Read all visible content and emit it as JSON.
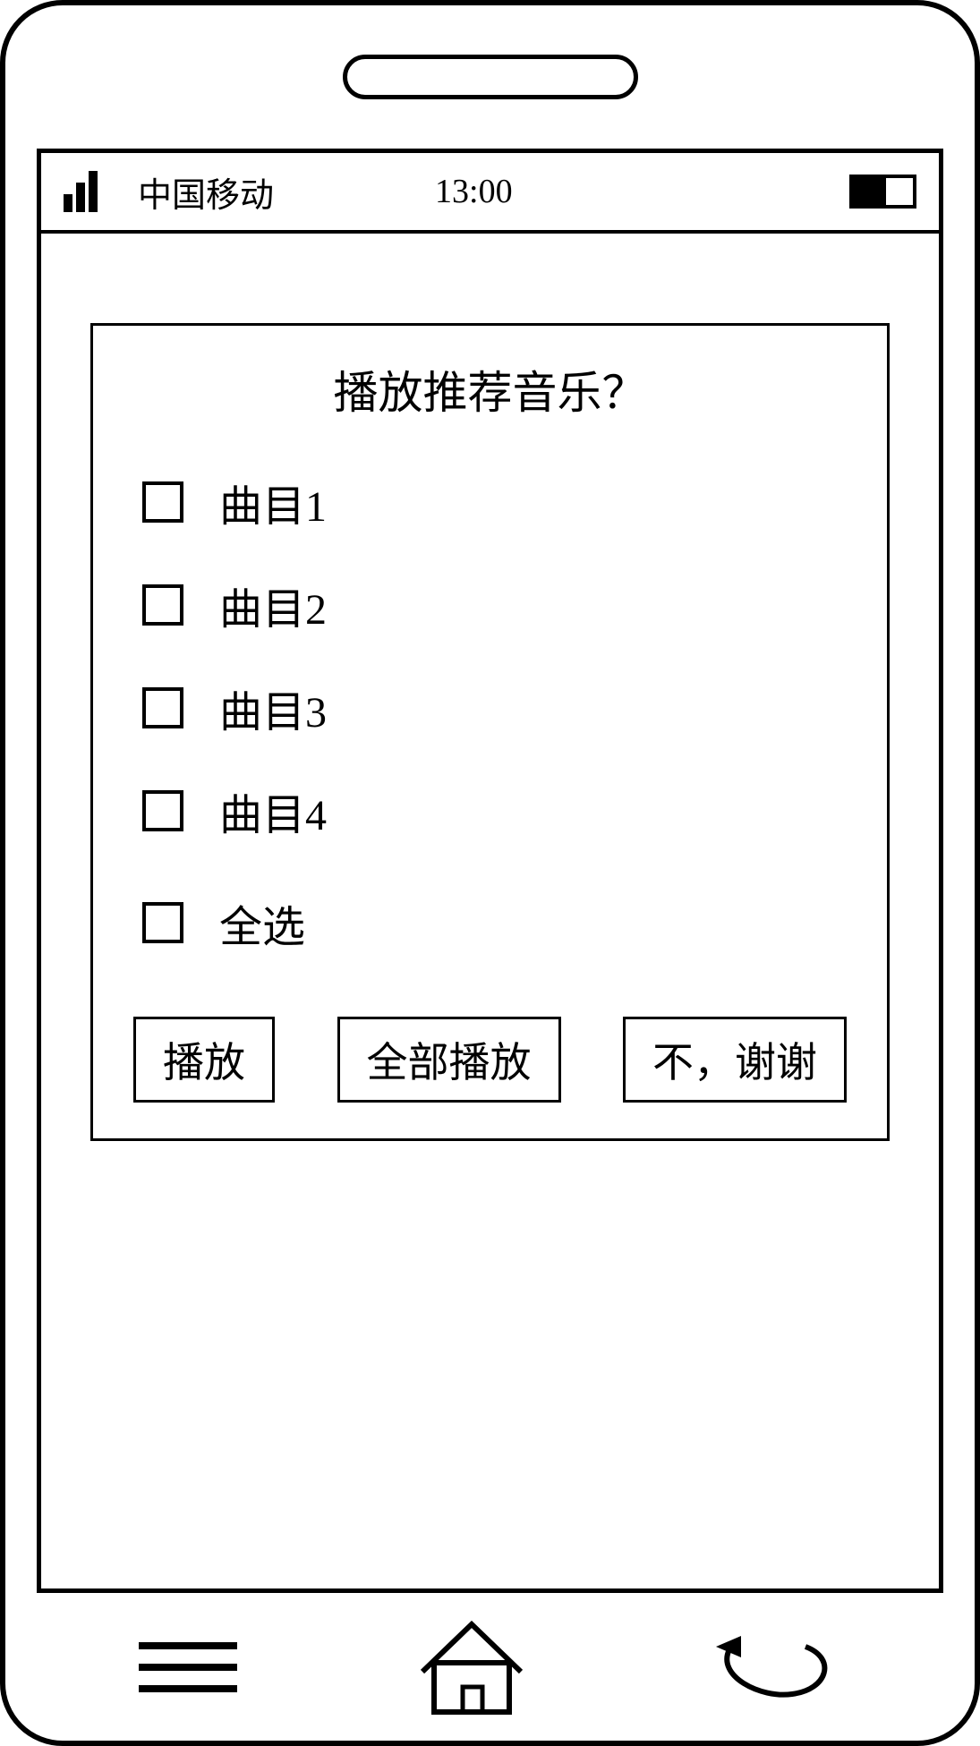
{
  "status_bar": {
    "carrier": "中国移动",
    "time": "13:00"
  },
  "dialog": {
    "title": "播放推荐音乐？",
    "tracks": [
      {
        "label": "曲目1"
      },
      {
        "label": "曲目2"
      },
      {
        "label": "曲目3"
      },
      {
        "label": "曲目4"
      }
    ],
    "select_all_label": "全选",
    "buttons": {
      "play": "播放",
      "play_all": "全部播放",
      "no_thanks": "不，谢谢"
    }
  }
}
